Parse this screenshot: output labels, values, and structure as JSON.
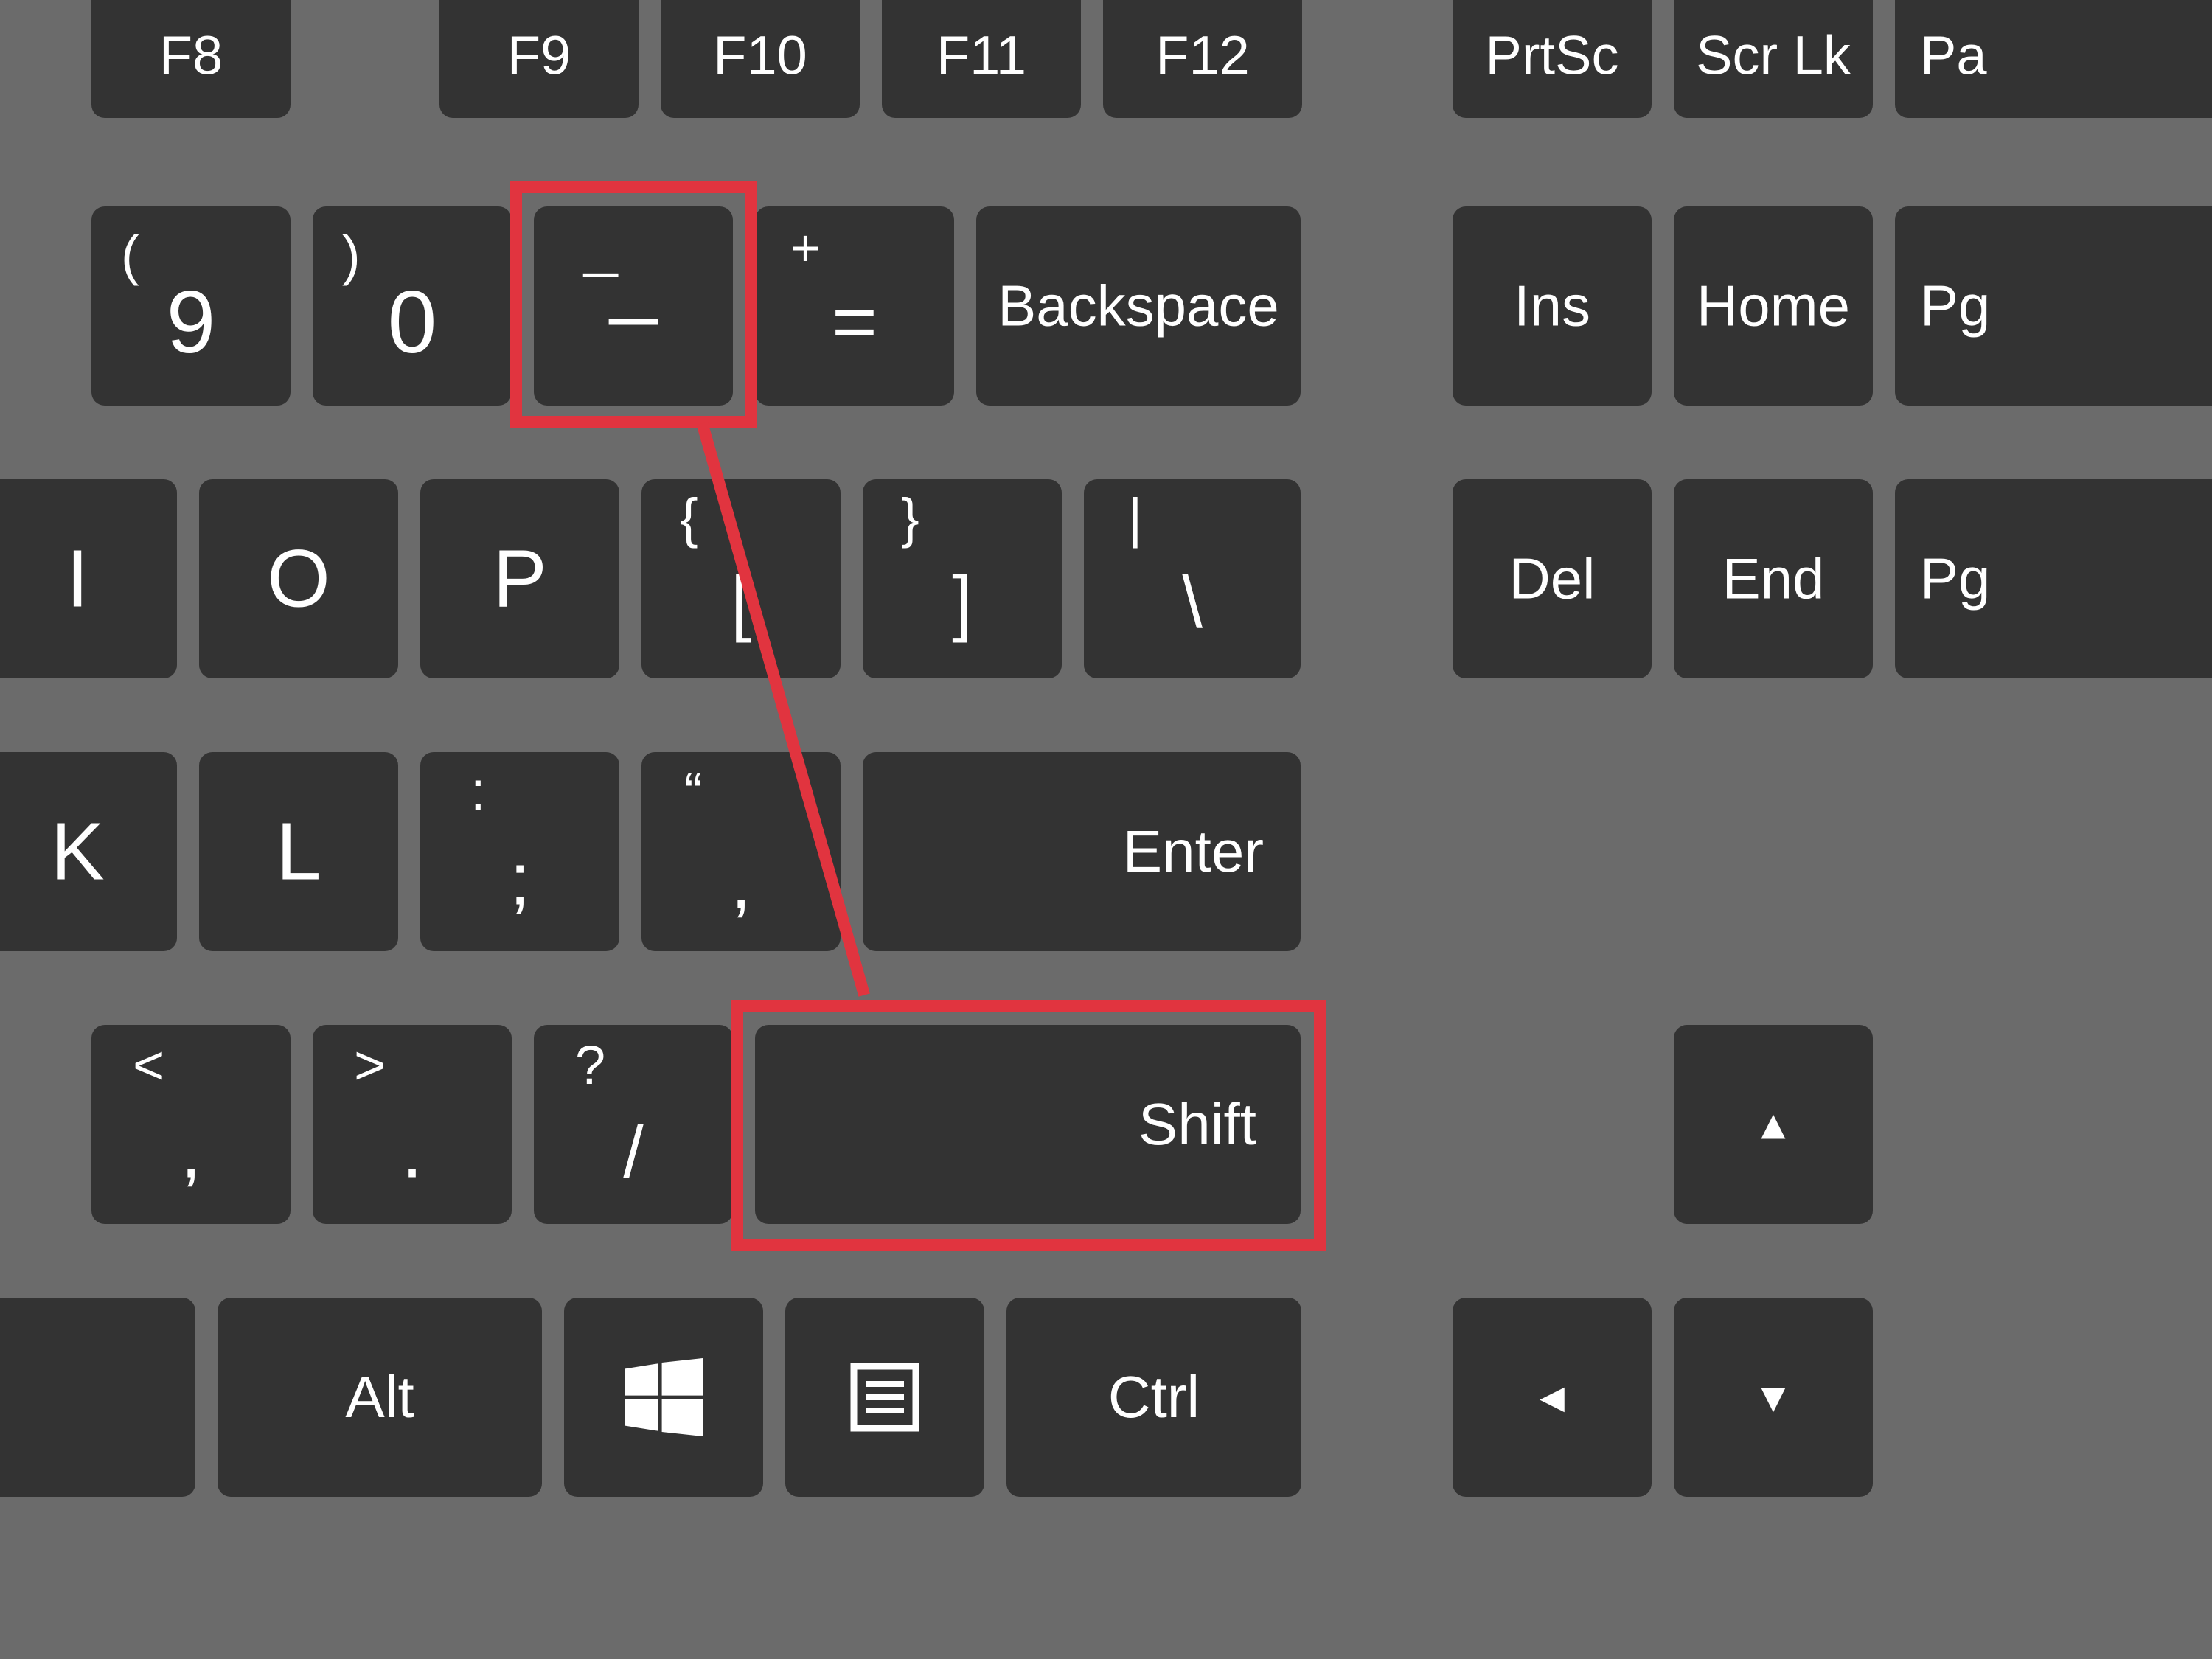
{
  "keyboard": {
    "row_function": {
      "f8": {
        "label": "F8"
      },
      "f9": {
        "label": "F9"
      },
      "f10": {
        "label": "F10"
      },
      "f11": {
        "label": "F11"
      },
      "f12": {
        "label": "F12"
      },
      "prtsc": {
        "label": "PrtSc"
      },
      "scrlk": {
        "label": "Scr Lk"
      },
      "pa": {
        "label": "Pa"
      }
    },
    "row_number": {
      "nine": {
        "upper": "(",
        "lower": "9"
      },
      "zero": {
        "upper": ")",
        "lower": "0"
      },
      "minus": {
        "upper": "_",
        "lower": "–"
      },
      "equals": {
        "upper": "+",
        "lower": "="
      },
      "backspace": {
        "label": "Backspace"
      },
      "ins": {
        "label": "Ins"
      },
      "home": {
        "label": "Home"
      },
      "pg1": {
        "label": "Pg"
      }
    },
    "row_qwerty": {
      "i": {
        "label": "I"
      },
      "o": {
        "label": "O"
      },
      "p": {
        "label": "P"
      },
      "bracket_open": {
        "upper": "{",
        "lower": "["
      },
      "bracket_close": {
        "upper": "}",
        "lower": "]"
      },
      "backslash": {
        "upper": "|",
        "lower": "\\"
      },
      "del": {
        "label": "Del"
      },
      "end": {
        "label": "End"
      },
      "pg2": {
        "label": "Pg"
      }
    },
    "row_home": {
      "k": {
        "label": "K"
      },
      "l": {
        "label": "L"
      },
      "semicolon": {
        "upper": ":",
        "lower": ";"
      },
      "quote": {
        "upper": "“",
        "lower": ","
      },
      "enter": {
        "label": "Enter"
      }
    },
    "row_shift": {
      "comma": {
        "upper": "<",
        "lower": ","
      },
      "period": {
        "upper": ">",
        "lower": "."
      },
      "slash": {
        "upper": "?",
        "lower": "/"
      },
      "shift": {
        "label": "Shift"
      },
      "up_arrow": {
        "symbol": "▲"
      }
    },
    "row_bottom": {
      "alt": {
        "label": "Alt"
      },
      "win": {
        "icon": "windows"
      },
      "menu": {
        "icon": "menu"
      },
      "ctrl": {
        "label": "Ctrl"
      },
      "left_arrow": {
        "symbol": "◄"
      },
      "down_arrow": {
        "symbol": "▼"
      }
    }
  },
  "highlights": {
    "minus_key": {
      "target": "minus-key"
    },
    "shift_key": {
      "target": "shift-key"
    }
  }
}
